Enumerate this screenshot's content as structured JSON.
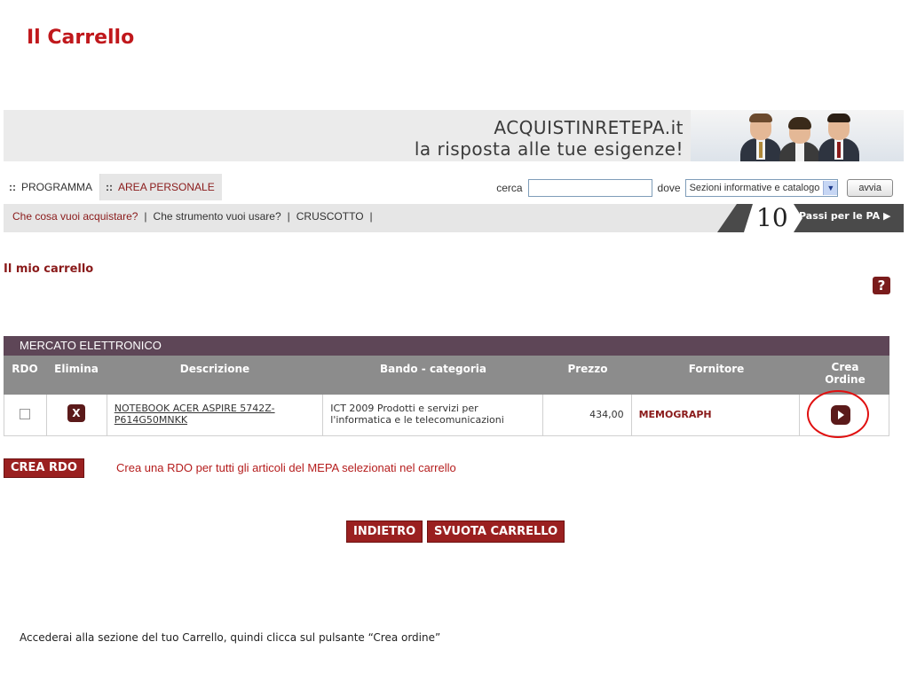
{
  "page": {
    "title": "Il Carrello"
  },
  "banner": {
    "line1": "ACQUISTINRETEPA.it",
    "line2": "la risposta alle tue esigenze!"
  },
  "nav": {
    "tabs": [
      {
        "label": "PROGRAMMA"
      },
      {
        "label": "AREA PERSONALE"
      }
    ],
    "bullet": "::",
    "search_label": "cerca",
    "search_value": "",
    "scope_label": "dove",
    "scope_value": "Sezioni informative e catalogo",
    "go_label": "avvia"
  },
  "subnav": {
    "links": [
      "Che cosa vuoi acquistare?",
      "Che strumento vuoi usare?",
      "CRUSCOTTO"
    ],
    "separator": "|",
    "passi_number": "10",
    "passi_label": "Passi per le PA"
  },
  "cart": {
    "heading": "Il mio carrello",
    "help": "?",
    "section_title": "MERCATO ELETTRONICO",
    "columns": [
      "RDO",
      "Elimina",
      "Descrizione",
      "Bando - categoria",
      "Prezzo",
      "Fornitore",
      "Crea Ordine"
    ],
    "row": {
      "delete_glyph": "X",
      "description": "NOTEBOOK ACER ASPIRE 5742Z-P614G50MNKK",
      "bando": "ICT 2009 Prodotti e servizi per l'informatica e le telecomunicazioni",
      "price": "434,00",
      "supplier": "MEMOGRAPH"
    }
  },
  "actions": {
    "crea_rdo_label": "CREA RDO",
    "crea_rdo_text": "Crea una RDO per tutti gli articoli del MEPA selezionati nel carrello",
    "back_label": "INDIETRO",
    "empty_label": "SVUOTA CARRELLO"
  },
  "caption": "Accederai alla sezione del tuo Carrello, quindi clicca sul pulsante “Crea ordine”",
  "colors": {
    "accent": "#c0181c",
    "button": "#9a2020",
    "table_title": "#5e4657",
    "table_head": "#8c8c8c"
  }
}
